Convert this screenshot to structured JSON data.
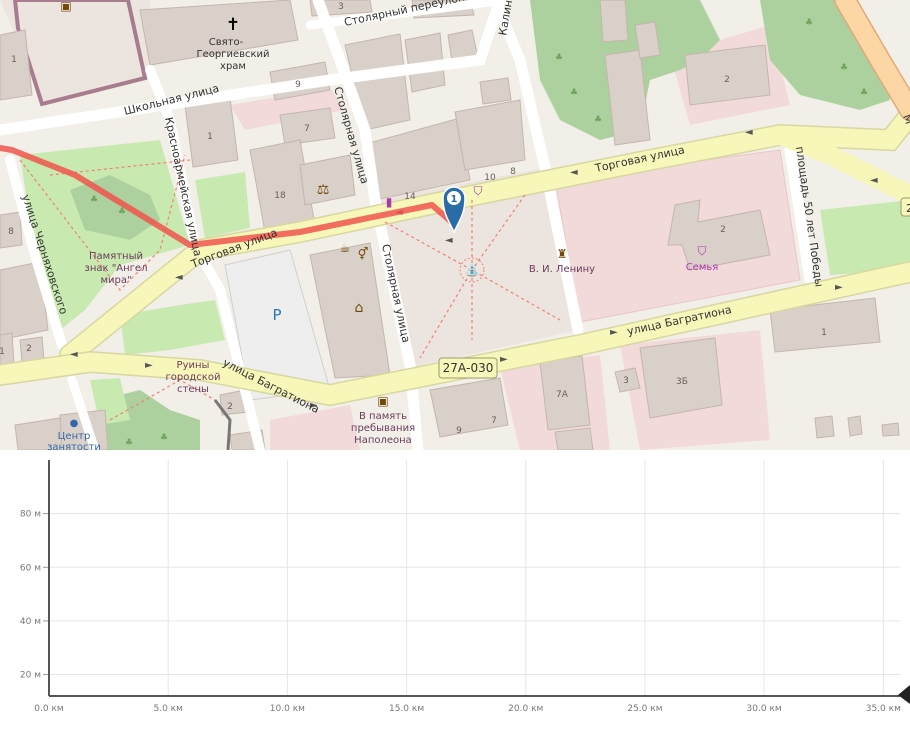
{
  "map": {
    "streets": {
      "stolyarny_pereulok": "Столярный переулок",
      "shkolnaya": "Школьная улица",
      "krasnoarmeyskaya": "Красноармейская улица",
      "stolyarnaya_top": "Столярная улица",
      "stolyarnaya_bottom": "Столярная улица",
      "torgovaya_right": "Торговая улица",
      "torgovaya_left": "Торговая улица",
      "bagrationa_right": "улица Багратиона",
      "bagrationa_left": "улица Багратиона",
      "chernyakhovskogo": "улица Черняховского",
      "ploshchad": "площадь 50 лет Победы",
      "kalinina": "Калини",
      "edge_right": "М"
    },
    "pois": {
      "church_line1": "Свято-",
      "church_line2": "Георгиевский",
      "church_line3": "храм",
      "monument_line1": "Памятный",
      "monument_line2": "знак \"Ангел",
      "monument_line3": "мира\"",
      "ruins_line1": "Руины",
      "ruins_line2": "городской",
      "ruins_line3": "стены",
      "napoleon_line1": "В память",
      "napoleon_line2": "пребывания",
      "napoleon_line3": "Наполеона",
      "lenin": "В. И. Ленину",
      "semya": "Семья",
      "center_line1": "Центр",
      "center_line2": "занятости",
      "parking_letter": "P"
    },
    "house_numbers": [
      "3",
      "1",
      "9",
      "7",
      "1",
      "18",
      "14",
      "10",
      "8",
      "2",
      "2",
      "1",
      "3",
      "3Б",
      "7А",
      "7",
      "9",
      "2",
      "8",
      "2",
      "1"
    ],
    "road_shield": "27А-030",
    "edge_shield": "2",
    "marker_number": "1",
    "colors": {
      "route": "#f0554d",
      "marker": "#2a6ca8",
      "pedestrian": "#ece5df",
      "road": "#f7f7ba",
      "park": "#c8eab0"
    }
  },
  "profile": {
    "y_ticks": [
      "80 м",
      "60 м",
      "40 м",
      "20 м"
    ],
    "x_ticks": [
      "0.0 км",
      "5.0 км",
      "10.0 км",
      "15.0 км",
      "20.0 км",
      "25.0 км",
      "30.0 км",
      "35.0 км"
    ]
  },
  "chart_data": {
    "type": "area",
    "title": "",
    "xlabel": "",
    "ylabel": "",
    "x_unit": "км",
    "y_unit": "м",
    "xlim": [
      0,
      35.7
    ],
    "ylim": [
      12,
      100
    ],
    "x": [
      0,
      35.7
    ],
    "values": [
      12,
      12
    ],
    "grid": true
  }
}
